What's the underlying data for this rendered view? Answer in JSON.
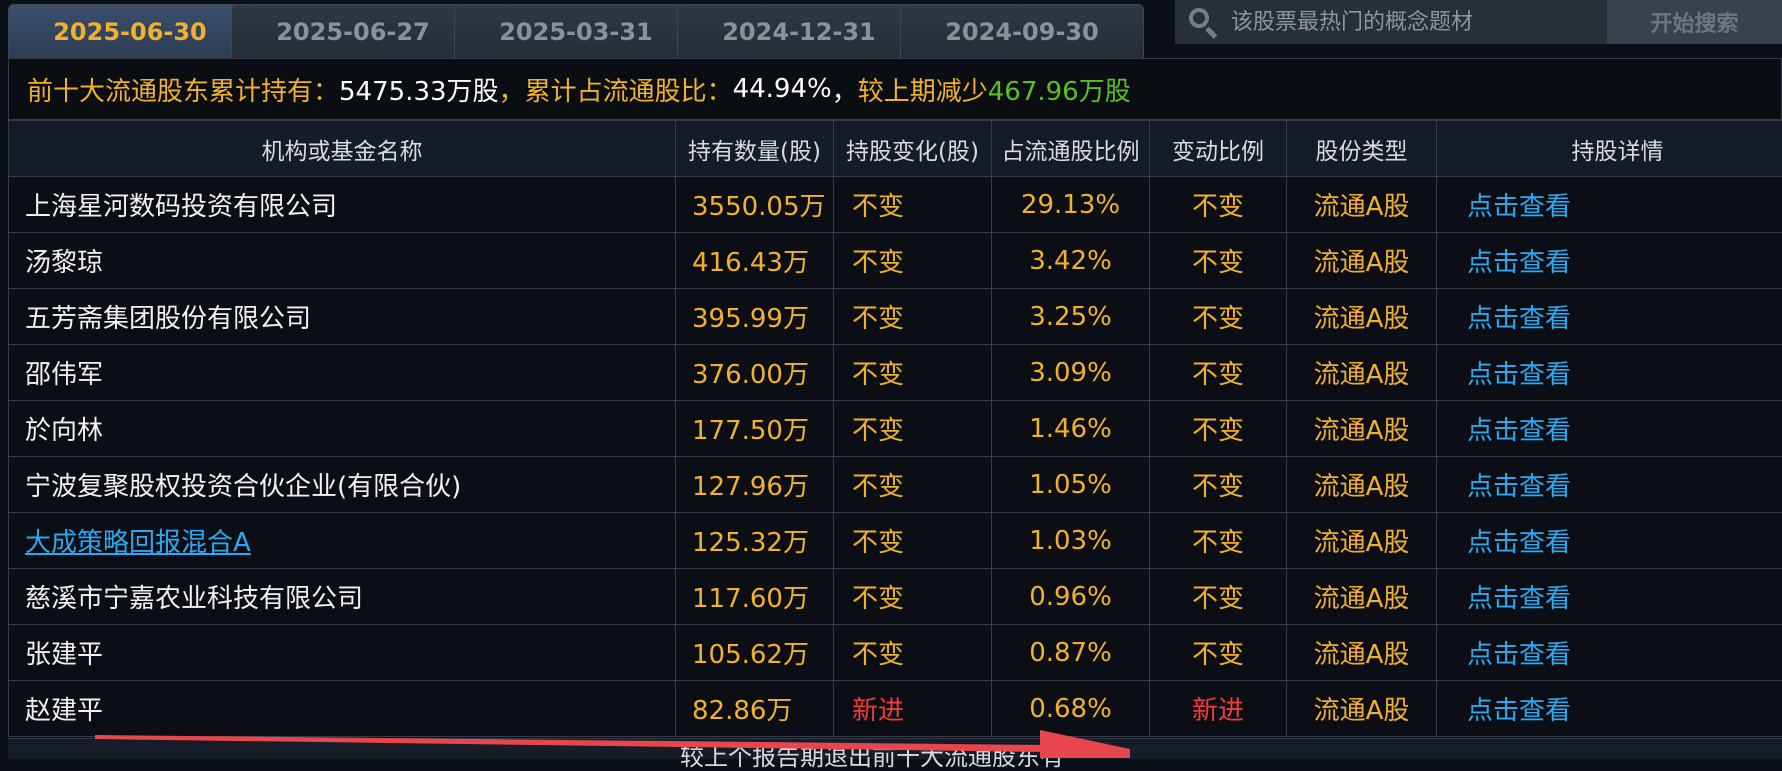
{
  "tabs": [
    "2025-06-30",
    "2025-06-27",
    "2025-03-31",
    "2024-12-31",
    "2024-09-30"
  ],
  "active_tab": 0,
  "search": {
    "placeholder": "该股票最热门的概念题材",
    "button_label": "开始搜索"
  },
  "summary": {
    "label1": "前十大流通股东累计持有：",
    "value1": "5475.33万股",
    "sep1": "，",
    "label2": "累计占流通股比：",
    "value2": "44.94%",
    "sep2": " ，",
    "label3": "较上期减少",
    "value3": "467.96万股"
  },
  "table": {
    "headers": [
      "机构或基金名称",
      "持有数量(股)",
      "持股变化(股)",
      "占流通股比例",
      "变动比例",
      "股份类型",
      "持股详情"
    ],
    "rows": [
      {
        "name": "上海星河数码投资有限公司",
        "amount": "3550.05万",
        "change": "不变",
        "pct": "29.13%",
        "ratio": "不变",
        "type": "流通A股",
        "detail": "点击查看"
      },
      {
        "name": "汤黎琼",
        "amount": "416.43万",
        "change": "不变",
        "pct": "3.42%",
        "ratio": "不变",
        "type": "流通A股",
        "detail": "点击查看"
      },
      {
        "name": "五芳斋集团股份有限公司",
        "amount": "395.99万",
        "change": "不变",
        "pct": "3.25%",
        "ratio": "不变",
        "type": "流通A股",
        "detail": "点击查看"
      },
      {
        "name": "邵伟军",
        "amount": "376.00万",
        "change": "不变",
        "pct": "3.09%",
        "ratio": "不变",
        "type": "流通A股",
        "detail": "点击查看"
      },
      {
        "name": "於向林",
        "amount": "177.50万",
        "change": "不变",
        "pct": "1.46%",
        "ratio": "不变",
        "type": "流通A股",
        "detail": "点击查看"
      },
      {
        "name": "宁波复聚股权投资合伙企业(有限合伙)",
        "amount": "127.96万",
        "change": "不变",
        "pct": "1.05%",
        "ratio": "不变",
        "type": "流通A股",
        "detail": "点击查看"
      },
      {
        "name": "大成策略回报混合A",
        "amount": "125.32万",
        "change": "不变",
        "pct": "1.03%",
        "ratio": "不变",
        "type": "流通A股",
        "detail": "点击查看",
        "link": true
      },
      {
        "name": "慈溪市宁嘉农业科技有限公司",
        "amount": "117.60万",
        "change": "不变",
        "pct": "0.96%",
        "ratio": "不变",
        "type": "流通A股",
        "detail": "点击查看"
      },
      {
        "name": "张建平",
        "amount": "105.62万",
        "change": "不变",
        "pct": "0.87%",
        "ratio": "不变",
        "type": "流通A股",
        "detail": "点击查看"
      },
      {
        "name": "赵建平",
        "amount": "82.86万",
        "change": "新进",
        "pct": "0.68%",
        "ratio": "新进",
        "type": "流通A股",
        "detail": "点击查看",
        "new": true
      }
    ]
  },
  "bottom_text": "较上个报告期退出前十大流通股东有",
  "colors": {
    "accent_orange": "#f2b12b",
    "link_blue": "#2aa8f2",
    "new_red": "#f23b3b",
    "decrease_green": "#5bbf26",
    "arrow_red": "#e8464c"
  }
}
